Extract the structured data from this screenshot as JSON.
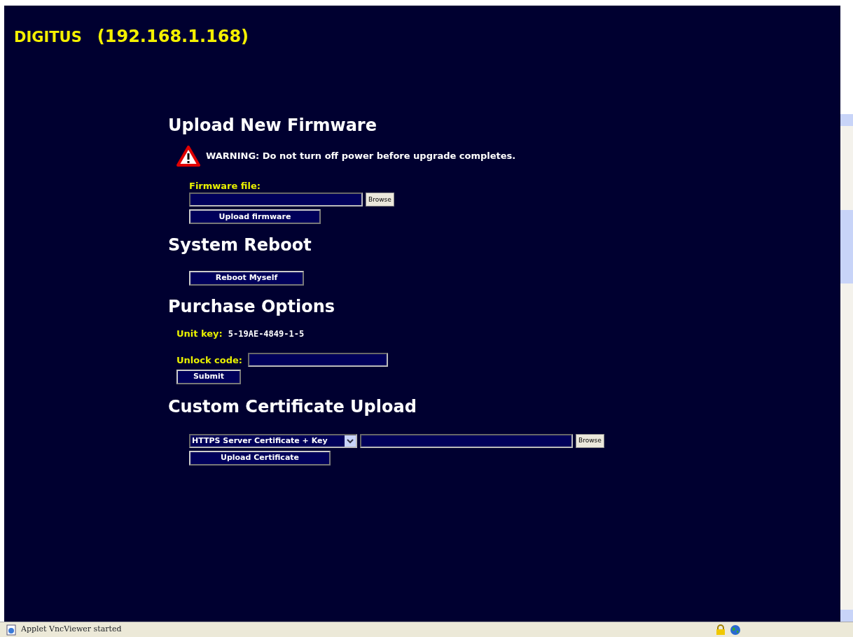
{
  "header": {
    "brand": "DIGITUS",
    "address": "(192.168.1.168)"
  },
  "firmware": {
    "title": "Upload New Firmware",
    "warning": "WARNING: Do not turn off power before upgrade completes.",
    "file_label": "Firmware file:",
    "browse": "Browse",
    "button": "Upload firmware"
  },
  "reboot": {
    "title": "System Reboot",
    "button": "Reboot Myself"
  },
  "purchase": {
    "title": "Purchase Options",
    "unit_key_label": "Unit key:",
    "unit_key": "5-19AE-4849-1-5",
    "unlock_label": "Unlock code:",
    "button": "Submit"
  },
  "certificate": {
    "title": "Custom Certificate Upload",
    "select_value": "HTTPS Server Certificate + Key",
    "browse": "Browse",
    "button": "Upload Certificate"
  },
  "status_bar": {
    "text": "Applet VncViewer started"
  }
}
